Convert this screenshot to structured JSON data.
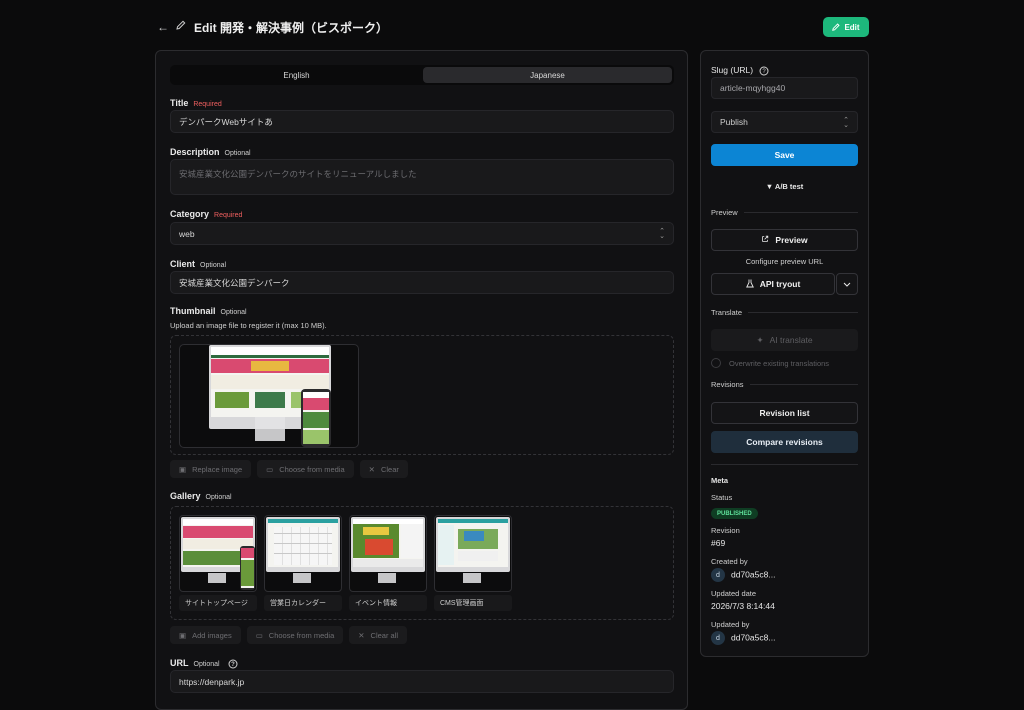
{
  "header": {
    "back_icon": "←",
    "title": "Edit 開発・解決事例（ビスポーク）",
    "edit_label": "Edit"
  },
  "tabs": [
    {
      "label": "English"
    },
    {
      "label": "Japanese"
    }
  ],
  "fields": {
    "title": {
      "label": "Title",
      "tag": "Required",
      "value": "デンパークWebサイトあ"
    },
    "description": {
      "label": "Description",
      "tag": "Optional",
      "placeholder": "安城産業文化公園デンパークのサイトをリニューアルしました"
    },
    "category": {
      "label": "Category",
      "tag": "Required",
      "value": "web"
    },
    "client": {
      "label": "Client",
      "tag": "Optional",
      "value": "安城産業文化公園デンパーク"
    },
    "thumbnail": {
      "label": "Thumbnail",
      "tag": "Optional",
      "helper": "Upload an image file to register it (max 10 MB)."
    },
    "gallery": {
      "label": "Gallery",
      "tag": "Optional"
    },
    "url": {
      "label": "URL",
      "tag": "Optional",
      "value": "https://denpark.jp"
    }
  },
  "thumb_actions": [
    {
      "label": "Replace image",
      "icon": "image-icon"
    },
    {
      "label": "Choose from media",
      "icon": "folder-icon"
    },
    {
      "label": "Clear",
      "icon": "x-icon"
    }
  ],
  "gallery_items": [
    {
      "caption": "サイトトップページ"
    },
    {
      "caption": "営業日カレンダー"
    },
    {
      "caption": "イベント情報"
    },
    {
      "caption": "CMS管理画面"
    }
  ],
  "gallery_actions": [
    {
      "label": "Add images"
    },
    {
      "label": "Choose from media"
    },
    {
      "label": "Clear all"
    }
  ],
  "sidebar": {
    "slug_label": "Slug (URL)",
    "slug_value": "article-mqyhgg40",
    "status_select": "Publish",
    "save_label": "Save",
    "ab_test_label": "▼ A/B test",
    "preview_section": "Preview",
    "preview_label": "Preview",
    "configure_preview": "Configure preview URL",
    "api_tryout_label": "API tryout",
    "translate_section": "Translate",
    "ai_translate_label": "AI translate",
    "overwrite_label": "Overwrite existing translations",
    "revisions_section": "Revisions",
    "revision_list_label": "Revision list",
    "compare_label": "Compare revisions",
    "meta": {
      "title": "Meta",
      "status_label": "Status",
      "status_value": "PUBLISHED",
      "revision_label": "Revision",
      "revision_value": "#69",
      "created_by_label": "Created by",
      "created_by_value": "dd70a5c8...",
      "updated_date_label": "Updated date",
      "updated_date_value": "2026/7/3 8:14:44",
      "updated_by_label": "Updated by",
      "updated_by_value": "dd70a5c8...",
      "avatar_initial": "d"
    }
  },
  "colors": {
    "accent": "#0c85d4",
    "edit": "#1db87c",
    "required": "#ef5f5f",
    "published": "#5fe09a"
  }
}
